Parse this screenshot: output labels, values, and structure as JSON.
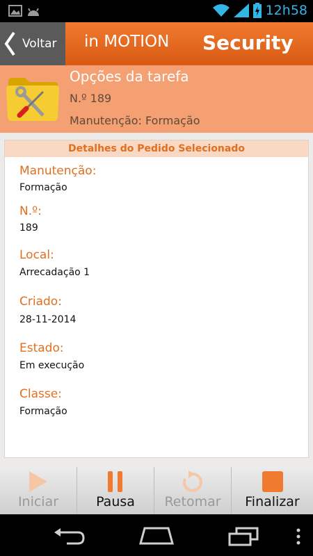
{
  "status": {
    "time": "12h58"
  },
  "appbar": {
    "back_label": "Voltar",
    "brand": "in MOTION",
    "section": "Security"
  },
  "task": {
    "title": "Opções da tarefa",
    "number": "N.º 189",
    "maintenance": "Manutenção: Formação"
  },
  "details": {
    "header": "Detalhes do Pedido Selecionado",
    "fields": [
      {
        "label": "Manutenção:",
        "value": "Formação"
      },
      {
        "label": "N.º:",
        "value": "189"
      },
      {
        "label": "Local:",
        "value": "Arrecadação 1"
      },
      {
        "label": "Criado:",
        "value": "28-11-2014"
      },
      {
        "label": "Estado:",
        "value": "Em execução"
      },
      {
        "label": "Classe:",
        "value": "Formação"
      }
    ]
  },
  "actions": [
    {
      "label": "Iniciar",
      "enabled": false
    },
    {
      "label": "Pausa",
      "enabled": true
    },
    {
      "label": "Retomar",
      "enabled": false
    },
    {
      "label": "Finalizar",
      "enabled": true
    }
  ],
  "colors": {
    "accent": "#f07a30",
    "disabled": "#999999",
    "enabled": "#111111"
  }
}
